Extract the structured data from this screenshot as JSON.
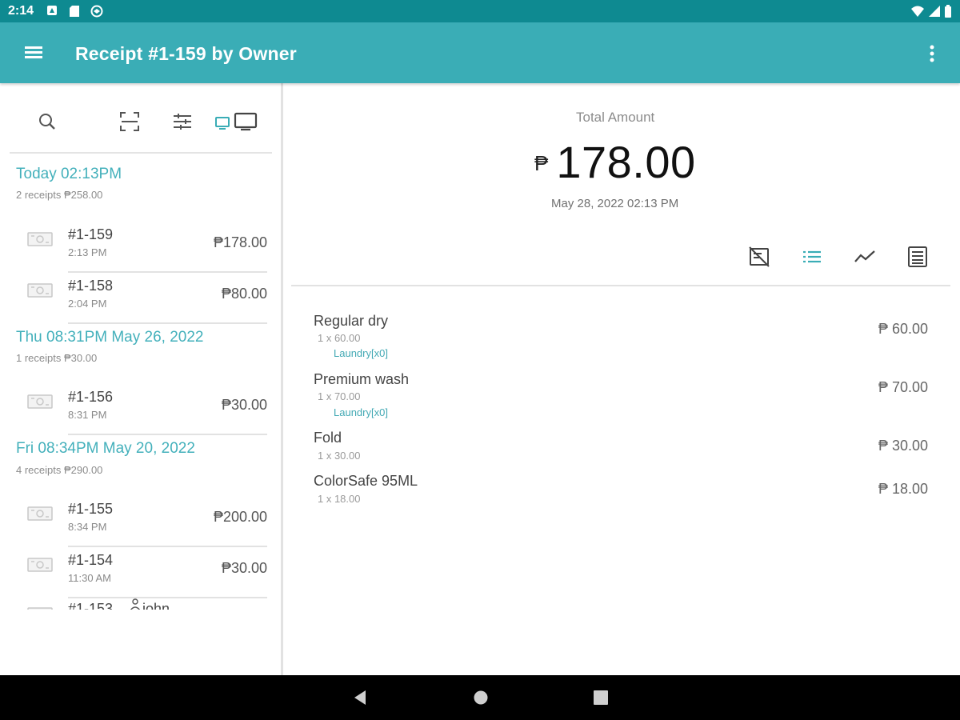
{
  "status_bar": {
    "time": "2:14",
    "icons": [
      "notification-icon",
      "sd-card-icon",
      "sync-icon",
      "wifi-icon",
      "signal-icon",
      "battery-icon"
    ]
  },
  "app_bar": {
    "title": "Receipt #1-159 by Owner",
    "menu_icon": "hamburger-menu-icon",
    "overflow_icon": "more-vertical-icon",
    "color": "#3aadb6"
  },
  "left_toolbar": {
    "icons": [
      "search-icon",
      "scan-icon",
      "filter-icon",
      "display-icon"
    ]
  },
  "receipts": {
    "groups": [
      {
        "title": "Today 02:13PM",
        "summary": "2 receipts ₱258.00",
        "items": [
          {
            "number": "#1-159",
            "time": "2:13 PM",
            "amount": "₱178.00"
          },
          {
            "number": "#1-158",
            "time": "2:04 PM",
            "amount": "₱80.00"
          }
        ]
      },
      {
        "title": "Thu 08:31PM May 26, 2022",
        "summary": "1 receipts ₱30.00",
        "items": [
          {
            "number": "#1-156",
            "time": "8:31 PM",
            "amount": "₱30.00"
          }
        ]
      },
      {
        "title": "Fri 08:34PM May 20, 2022",
        "summary": "4 receipts ₱290.00",
        "items": [
          {
            "number": "#1-155",
            "time": "8:34 PM",
            "amount": "₱200.00"
          },
          {
            "number": "#1-154",
            "time": "11:30 AM",
            "amount": "₱30.00"
          },
          {
            "number": "#1-153",
            "time": "",
            "amount": "",
            "customer": "john"
          }
        ]
      }
    ]
  },
  "detail": {
    "total_label": "Total Amount",
    "currency": "₱",
    "total": "178.00",
    "date": "May 28, 2022 02:13 PM",
    "actions": [
      "no-receipt-icon",
      "list-icon",
      "trend-icon",
      "receipt-doc-icon"
    ],
    "items": [
      {
        "name": "Regular dry",
        "qty": "1 x 60.00",
        "modifier": "Laundry[x0]",
        "price": "₱ 60.00"
      },
      {
        "name": "Premium wash",
        "qty": "1 x 70.00",
        "modifier": "Laundry[x0]",
        "price": "₱ 70.00"
      },
      {
        "name": "Fold",
        "qty": "1 x 30.00",
        "modifier": "",
        "price": "₱ 30.00"
      },
      {
        "name": "ColorSafe 95ML",
        "qty": "1 x 18.00",
        "modifier": "",
        "price": "₱ 18.00"
      }
    ]
  },
  "nav_bar": {
    "icons": [
      "back-icon",
      "home-icon",
      "recents-icon"
    ]
  }
}
